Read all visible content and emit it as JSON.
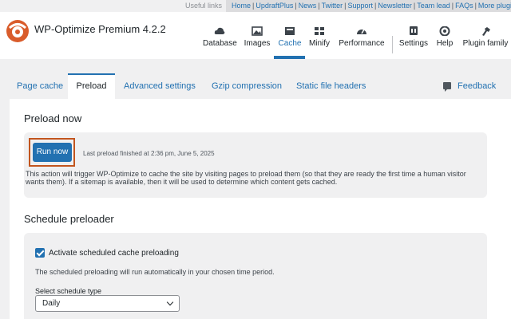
{
  "top_bar": {
    "label": "Useful links",
    "links": [
      "Home",
      "UpdraftPlus",
      "News",
      "Twitter",
      "Support",
      "Newsletter",
      "Team lead",
      "FAQs",
      "More plugins"
    ]
  },
  "header": {
    "title": "WP-Optimize Premium 4.2.2",
    "nav": [
      {
        "label": "Database",
        "icon": "cloud-icon"
      },
      {
        "label": "Images",
        "icon": "images-icon"
      },
      {
        "label": "Cache",
        "icon": "cache-icon",
        "active": true
      },
      {
        "label": "Minify",
        "icon": "minify-icon"
      },
      {
        "label": "Performance",
        "icon": "gauge-icon"
      },
      {
        "label": "Settings",
        "icon": "settings-icon"
      },
      {
        "label": "Help",
        "icon": "help-icon"
      },
      {
        "label": "Plugin family",
        "icon": "plugin-icon"
      }
    ]
  },
  "tabs": {
    "items": [
      "Page cache",
      "Preload",
      "Advanced settings",
      "Gzip compression",
      "Static file headers"
    ],
    "active": "Preload",
    "feedback": "Feedback"
  },
  "preload": {
    "title": "Preload now",
    "button": "Run now",
    "last_preload": "Last preload finished at 2:36 pm, June 5, 2025",
    "description": "This action will trigger WP-Optimize to cache the site by visiting pages to preload them (so that they are ready the first time a human visitor wants them). If a sitemap is available, then it will be used to determine which content gets cached."
  },
  "schedule": {
    "title": "Schedule preloader",
    "checkbox_label": "Activate scheduled cache preloading",
    "checkbox_checked": true,
    "note": "The scheduled preloading will run automatically in your chosen time period.",
    "select_label": "Select schedule type",
    "select_value": "Daily"
  },
  "colors": {
    "accent": "#2271b1",
    "highlight": "#c2551e",
    "logo": "#d95c2b"
  }
}
